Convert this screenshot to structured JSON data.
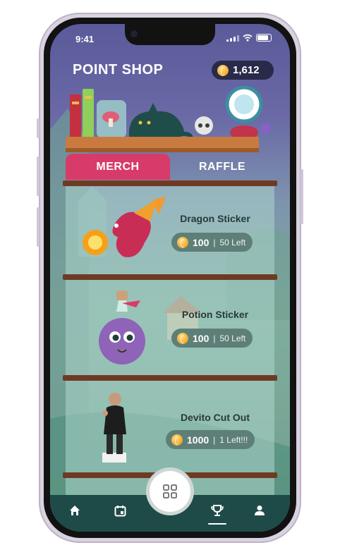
{
  "status_bar": {
    "time": "9:41"
  },
  "header": {
    "title": "POINT SHOP",
    "balance": "1,612"
  },
  "tabs": [
    {
      "label": "MERCH",
      "active": true
    },
    {
      "label": "RAFFLE",
      "active": false
    }
  ],
  "items": [
    {
      "name": "Dragon Sticker",
      "price": "100",
      "stock": "50 Left"
    },
    {
      "name": "Potion Sticker",
      "price": "100",
      "stock": "50 Left"
    },
    {
      "name": "Devito Cut Out",
      "price": "1000",
      "stock": "1 Left!!!"
    }
  ],
  "nav": {
    "items": [
      {
        "icon": "home-icon"
      },
      {
        "icon": "calendar-icon"
      },
      {
        "icon": "trophy-icon",
        "selected": true
      },
      {
        "icon": "profile-icon"
      }
    ],
    "center": {
      "icon": "qr-code-icon"
    }
  },
  "colors": {
    "accent_tab": "#d83b69",
    "nav_bar": "#1e4b48",
    "shelf_board": "#6e3a24",
    "balance_pill": "#29294a"
  }
}
